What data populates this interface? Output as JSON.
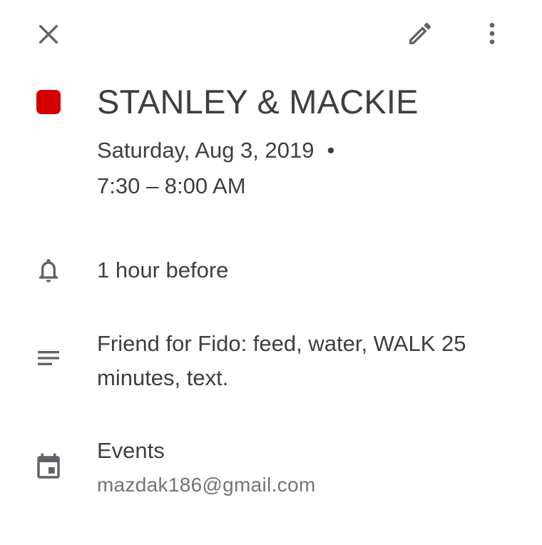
{
  "toolbar": {
    "close_icon": "close-icon",
    "edit_icon": "pencil-icon",
    "more_icon": "more-vert-icon"
  },
  "event": {
    "color": "#d50000",
    "title": "STANLEY & MACKIE",
    "date": "Saturday, Aug 3, 2019",
    "separator": "•",
    "time": "7:30 – 8:00 AM"
  },
  "reminder": {
    "icon": "bell-icon",
    "text": "1 hour before"
  },
  "description": {
    "icon": "notes-icon",
    "text": "Friend for Fido:  feed, water, WALK 25 minutes, text."
  },
  "calendar": {
    "icon": "calendar-icon",
    "name": "Events",
    "account": "mazdak186@gmail.com"
  }
}
